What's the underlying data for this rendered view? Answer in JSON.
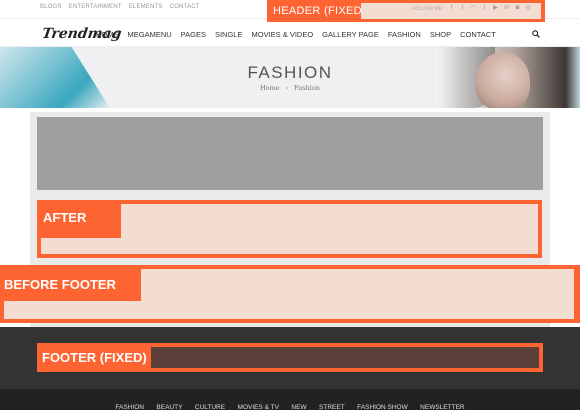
{
  "topbar": {
    "links": [
      "BLOGS",
      "ENTERTAINMENT",
      "ELEMENTS",
      "CONTACT"
    ],
    "fixed_label": "HEADER (FIXED)",
    "follow_label": "FOLLOW ME:",
    "social_icons": [
      "facebook-icon",
      "twitter-icon",
      "rss-icon",
      "tumblr-icon",
      "youtube-icon",
      "linkedin-icon",
      "instagram-icon",
      "dribbble-icon"
    ]
  },
  "nav": {
    "logo": "Trendmag",
    "items": [
      "HOME",
      "MEGAMENU",
      "PAGES",
      "SINGLE",
      "MOVIES & VIDEO",
      "GALLERY PAGE",
      "FASHION",
      "SHOP",
      "CONTACT"
    ]
  },
  "hero": {
    "title": "FASHION",
    "breadcrumb_home": "Home",
    "breadcrumb_sep": "›",
    "breadcrumb_current": "Fashion"
  },
  "sections": {
    "after_label": "AFTER",
    "before_footer_label": "BEFORE FOOTER",
    "footer_fixed_label": "FOOTER (FIXED)"
  },
  "bottom": {
    "links": [
      "FASHION",
      "BEAUTY",
      "CULTURE",
      "MOVIES & TV",
      "NEW",
      "STREET",
      "FASHION SHOW",
      "NEWSLETTER"
    ]
  },
  "colors": {
    "accent": "#fe6332",
    "highlight": "#f3ddd3"
  }
}
